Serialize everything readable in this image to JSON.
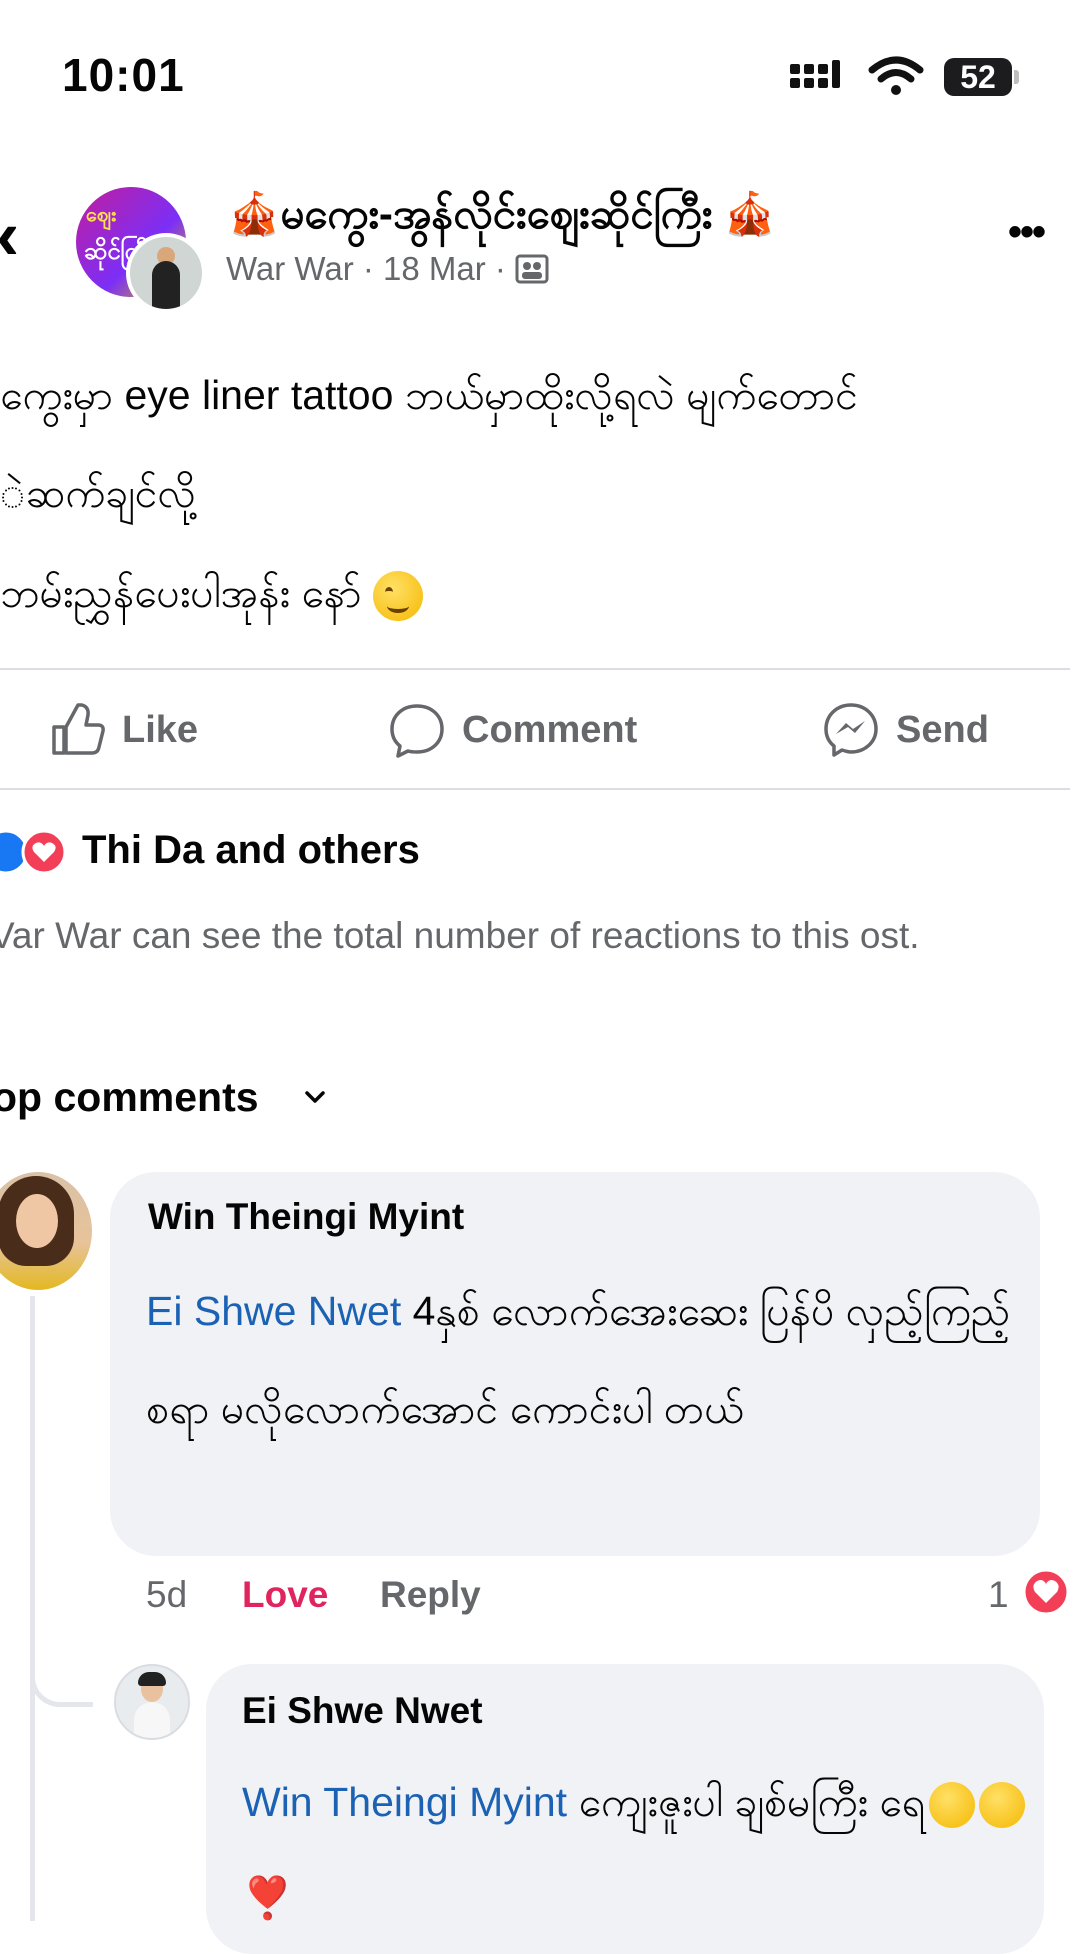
{
  "status_bar": {
    "time": "10:01",
    "battery": "52"
  },
  "header": {
    "back_icon": "chevron-left-icon",
    "page_title": "🎪မကွေး-အွန်လိုင်းဈေးဆိုင်ကြီး 🎪",
    "meta": "War War · 18 Mar · ",
    "more_icon": "more-dots-icon",
    "avatar_text_1": "ဈေး",
    "avatar_text_2": "ဆိုင်ကြီး"
  },
  "post": {
    "line1": "ကွေးမှာ eye liner tattoo ဘယ်မှာထိုးလို့ရလဲ မျက်တောင်",
    "line2": "ဲဆက်ချင်လို့",
    "line3": "ဘမ်းညွှန်ပေးပါအုန်း နော် "
  },
  "actions": {
    "like": "Like",
    "comment": "Comment",
    "send": "Send"
  },
  "reactions": {
    "summary": "Thi Da and others",
    "visibility_note": "Var War can see the total number of reactions to this ost."
  },
  "comments_section": {
    "sort_label": "op comments"
  },
  "comments": [
    {
      "author": "Win Theingi Myint",
      "mention": "Ei Shwe Nwet",
      "text": " 4နှစ် လောက်အေးဆေး ပြန်ပိ လှည့်ကြည့်စရာ မလိုလောက်အောင် ကောင်းပါ တယ်",
      "time": "5d",
      "love_label": "Love",
      "reply_label": "Reply",
      "reaction_count": "1"
    }
  ],
  "replies": [
    {
      "author": "Ei Shwe Nwet",
      "mention": "Win Theingi Myint",
      "text": " ကျေးဇူးပါ ချစ်မကြီး ရေ",
      "emoji_tail": "❣️"
    }
  ],
  "colors": {
    "accent_blue": "#1b62b5",
    "love_red": "#e0245e",
    "muted": "#65676b",
    "bubble": "#f0f2f5"
  }
}
